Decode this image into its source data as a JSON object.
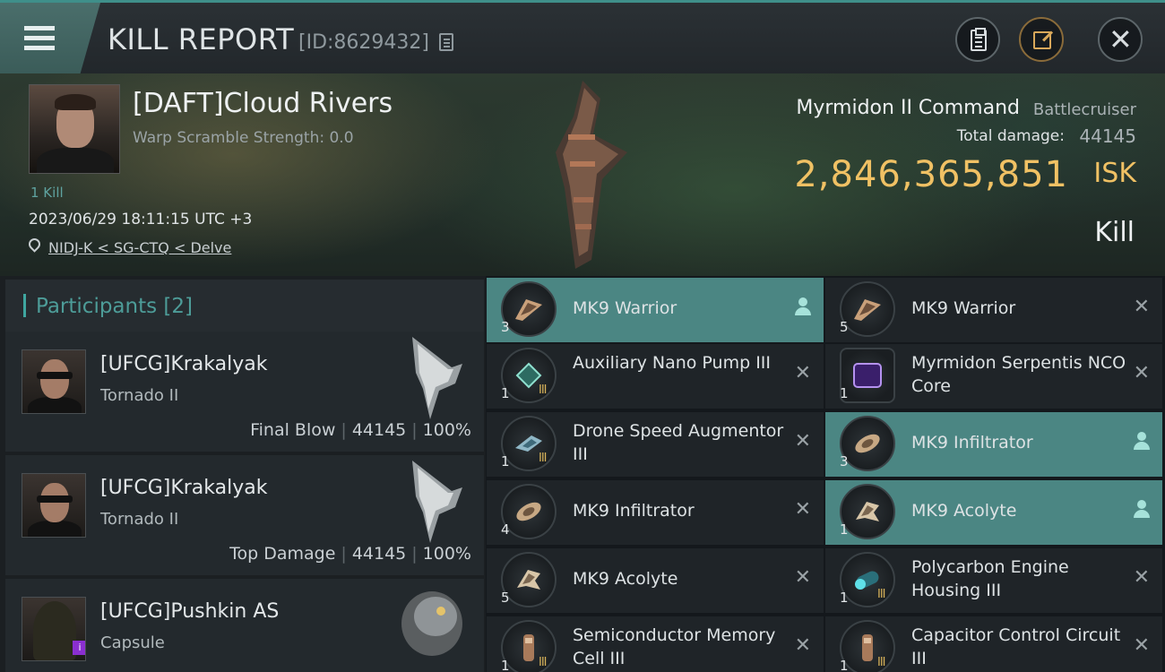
{
  "header": {
    "title": "KILL REPORT",
    "id_label": "[ID:8629432]"
  },
  "victim": {
    "name": "[DAFT]Cloud Rivers",
    "warp_scramble": "Warp Scramble Strength: 0.0",
    "kills": "1 Kill",
    "timestamp": "2023/06/29 18:11:15 UTC +3",
    "location": "NIDJ-K < SG-CTQ < Delve",
    "ship_name": "Myrmidon II Command",
    "ship_class": "Battlecruiser",
    "total_damage_label": "Total damage:",
    "total_damage": "44145",
    "isk_value": "2,846,365,851",
    "isk_unit": "ISK",
    "type": "Kill"
  },
  "participants": {
    "title": "Participants [2]",
    "list": [
      {
        "name": "[UFCG]Krakalyak",
        "ship": "Tornado II",
        "role": "Final Blow",
        "damage": "44145",
        "percent": "100%"
      },
      {
        "name": "[UFCG]Krakalyak",
        "ship": "Tornado II",
        "role": "Top Damage",
        "damage": "44145",
        "percent": "100%"
      },
      {
        "name": "[UFCG]Pushkin AS",
        "ship": "Capsule"
      }
    ]
  },
  "items": [
    {
      "qty": "3",
      "name": "MK9  Warrior",
      "tier": "",
      "status": "dropped"
    },
    {
      "qty": "5",
      "name": "MK9  Warrior",
      "tier": "",
      "status": "destroyed"
    },
    {
      "qty": "1",
      "name": "Auxiliary Nano Pump III",
      "tier": "III",
      "status": "destroyed"
    },
    {
      "qty": "1",
      "name": "Myrmidon Serpentis NCO Core",
      "tier": "",
      "status": "destroyed"
    },
    {
      "qty": "1",
      "name": "Drone Speed Augmentor III",
      "tier": "III",
      "status": "destroyed"
    },
    {
      "qty": "3",
      "name": "MK9  Infiltrator",
      "tier": "",
      "status": "dropped"
    },
    {
      "qty": "4",
      "name": "MK9  Infiltrator",
      "tier": "",
      "status": "destroyed"
    },
    {
      "qty": "1",
      "name": "MK9  Acolyte",
      "tier": "",
      "status": "dropped"
    },
    {
      "qty": "5",
      "name": "MK9  Acolyte",
      "tier": "",
      "status": "destroyed"
    },
    {
      "qty": "1",
      "name": "Polycarbon Engine Housing III",
      "tier": "III",
      "status": "destroyed"
    },
    {
      "qty": "1",
      "name": "Semiconductor Memory Cell III",
      "tier": "III",
      "status": "destroyed"
    },
    {
      "qty": "1",
      "name": "Capacitor Control Circuit III",
      "tier": "III",
      "status": "destroyed"
    }
  ],
  "icons": {
    "menu": "hamburger-icon",
    "copy": "copy-icon",
    "clipboard": "clipboard-icon",
    "share": "share-icon",
    "close": "close-icon",
    "location": "location-pin-icon",
    "dropped": "user-icon",
    "destroyed": "x-icon"
  },
  "colors": {
    "accent": "#3fa6a0",
    "isk": "#f0c164",
    "dropped_bg": "#4b8683"
  }
}
